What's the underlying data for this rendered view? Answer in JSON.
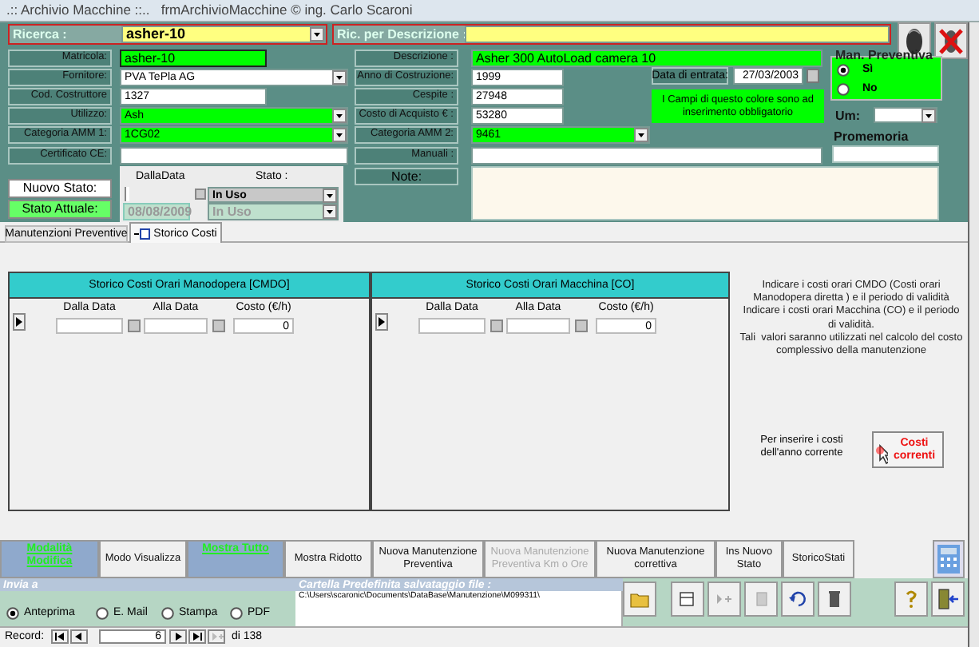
{
  "window": {
    "title": ".:: Archivio Macchine ::..   frmArchivioMacchine © ing. Carlo Scaroni"
  },
  "search": {
    "label": "Ricerca :",
    "value": "asher-10"
  },
  "description_search": {
    "label": "Ric. per Descrizione :"
  },
  "left_fields": [
    {
      "label": "Matricola:",
      "value": "asher-10",
      "kind": "field",
      "required": true
    },
    {
      "label": "Fornitore:",
      "value": "PVA TePla AG",
      "kind": "combo",
      "required": false
    },
    {
      "label": "Cod. Costruttore",
      "value": "1327",
      "kind": "field",
      "required": false
    },
    {
      "label": "Utilizzo:",
      "value": "Ash",
      "kind": "combo",
      "required": true
    },
    {
      "label": "Categoria AMM 1:",
      "value": "1CG02",
      "kind": "combo",
      "required": true
    },
    {
      "label": "Certificato CE:",
      "kind": "field",
      "required": false
    }
  ],
  "right_fields": [
    {
      "label": "Descrizione :",
      "value": "Asher 300 AutoLoad camera 10",
      "kind": "field",
      "required": true
    },
    {
      "label": "Anno di Costruzione:",
      "value": "1999",
      "kind": "field",
      "required": false
    },
    {
      "label": "Cespite :",
      "value": "27948",
      "kind": "field",
      "required": false
    },
    {
      "label": "Costo di Acquisto € :",
      "value": "53280",
      "kind": "field",
      "required": false
    },
    {
      "label": "Categoria AMM 2:",
      "value": "9461",
      "kind": "combo",
      "required": true
    },
    {
      "label": "Manuali :",
      "kind": "field",
      "required": false
    }
  ],
  "note": {
    "label": "Note:"
  },
  "entry_date": {
    "label": "Data di entrata:",
    "value": "27/03/2003"
  },
  "legend_note": "I Campi di questo colore sono ad inserimento obbligatorio",
  "preventive_maintenance": {
    "title": "Man. Preventiva",
    "options": [
      {
        "label": "Sì",
        "selected": true
      },
      {
        "label": "No",
        "selected": false
      }
    ]
  },
  "um": {
    "label": "Um:"
  },
  "reminder": {
    "label": "Promemoria"
  },
  "status": {
    "new_label": "Nuovo Stato:",
    "current_label": "Stato Attuale:",
    "date_column": "DallaData",
    "state_column": "Stato :",
    "new_value": "In Uso",
    "current_date": "08/08/2009",
    "current_value": "In Uso"
  },
  "tabs": [
    {
      "label": "Manutenzioni Preventive",
      "selected": false
    },
    {
      "label": "Storico Costi",
      "selected": true
    }
  ],
  "cost_tables": [
    {
      "title": "Storico Costi Orari Manodopera [CMDO]",
      "columns": [
        "Dalla Data",
        "Alla Data",
        "Costo (€/h)"
      ],
      "cost": "0"
    },
    {
      "title": "Storico Costi Orari Macchina [CO]",
      "columns": [
        "Dalla Data",
        "Alla Data",
        "Costo (€/h)"
      ],
      "cost": "0"
    }
  ],
  "info_text": [
    "Indicare i costi orari CMDO (Costi orari Manodopera diretta ) e il periodo di validità",
    "Indicare i costi orari Macchina (CO) e il periodo di validità.",
    "Tali  valori saranno utilizzati nel calcolo del costo complessivo della manutenzione"
  ],
  "current_costs": {
    "hint": "Per inserire i costi dell'anno corrente",
    "button": "Costi correnti"
  },
  "actions": [
    {
      "label": "Modalità Modifica",
      "selected": true,
      "disabled": false
    },
    {
      "label": "Modo Visualizza",
      "selected": false,
      "disabled": false
    },
    {
      "label": "Mostra Tutto",
      "selected": true,
      "disabled": false
    },
    {
      "label": "Mostra Ridotto",
      "selected": false,
      "disabled": false
    },
    {
      "label": "Nuova Manutenzione Preventiva",
      "selected": false,
      "disabled": false
    },
    {
      "label": "Nuova Manutenzione Preventiva Km o Ore",
      "selected": false,
      "disabled": true
    },
    {
      "label": "Nuova Manutenzione correttiva",
      "selected": false,
      "disabled": false
    },
    {
      "label": "Ins Nuovo Stato",
      "selected": false,
      "disabled": false
    },
    {
      "label": "StoricoStati",
      "selected": false,
      "disabled": false
    }
  ],
  "send_to": {
    "title": "Invia a",
    "options": [
      {
        "label": "Anteprima",
        "selected": true
      },
      {
        "label": "E. Mail",
        "selected": false
      },
      {
        "label": "Stampa",
        "selected": false
      },
      {
        "label": "PDF",
        "selected": false
      }
    ]
  },
  "folder": {
    "title": "Cartella Predefinita salvataggio file :",
    "path": "C:\\Users\\scaronic\\Documents\\DataBase\\Manutenzione\\M099311\\"
  },
  "record_nav": {
    "label": "Record:",
    "current": "6",
    "total": "di 138"
  }
}
